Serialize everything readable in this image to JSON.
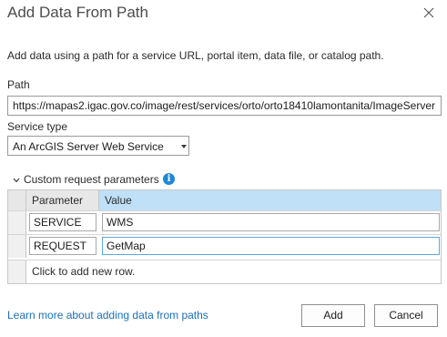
{
  "dialog": {
    "title": "Add Data From Path",
    "description": "Add data using a path for a service URL, portal item, data file, or catalog path."
  },
  "path": {
    "label": "Path",
    "value": "https://mapas2.igac.gov.co/image/rest/services/orto/orto18410lamontanita/ImageServer"
  },
  "service_type": {
    "label": "Service type",
    "selected": "An ArcGIS Server Web Service"
  },
  "custom_params": {
    "section_label": "Custom request parameters",
    "info_glyph": "i",
    "columns": [
      "Parameter",
      "Value"
    ],
    "rows": [
      {
        "parameter": "SERVICE",
        "value": "WMS"
      },
      {
        "parameter": "REQUEST",
        "value": "GetMap"
      }
    ],
    "add_row_text": "Click to add new row."
  },
  "footer": {
    "learn_more": "Learn more about adding data from paths",
    "add_label": "Add",
    "cancel_label": "Cancel"
  },
  "icons": {
    "close": "close-icon",
    "chevron": "chevron-down-icon",
    "info": "info-icon",
    "dropdown": "dropdown-caret-icon"
  },
  "colors": {
    "accent": "#1e88d8",
    "header_selected": "#bfe0f6",
    "link": "#1f6fb5"
  }
}
